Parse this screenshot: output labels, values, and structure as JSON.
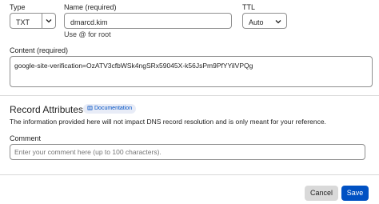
{
  "type_field": {
    "label": "Type",
    "value": "TXT"
  },
  "name_field": {
    "label": "Name (required)",
    "value": "dmarcd.kim",
    "helper": "Use @ for root"
  },
  "ttl_field": {
    "label": "TTL",
    "value": "Auto"
  },
  "content_field": {
    "label": "Content (required)",
    "value": "google-site-verification=OzATV3cfbWSk4ngSRx59045X-k56JsPm9PfYYilVPQg"
  },
  "record_attributes": {
    "title": "Record Attributes",
    "doc_label": "Documentation",
    "description": "The information provided here will not impact DNS record resolution and is only meant for your reference."
  },
  "comment_field": {
    "label": "Comment",
    "placeholder": "Enter your comment here (up to 100 characters)."
  },
  "actions": {
    "cancel_label": "Cancel",
    "save_label": "Save"
  },
  "colors": {
    "primary": "#0051c3",
    "doc_badge_bg": "#e8ecf7",
    "cancel_bg": "#d9d9d9"
  }
}
